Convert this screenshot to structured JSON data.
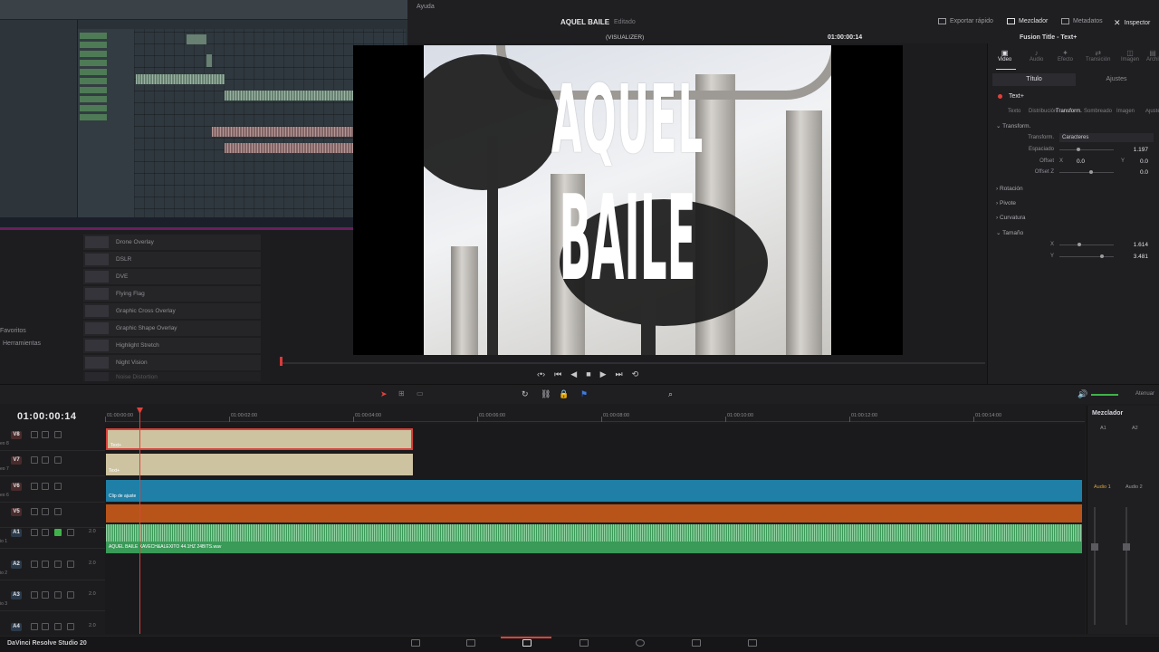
{
  "menu": {
    "help": "Ayuda"
  },
  "project": {
    "name": "AQUEL BAILE",
    "status": "Editado"
  },
  "topbar": {
    "quick_export": "Exportar rápido",
    "mixer": "Mezclador",
    "metadata": "Metadatos",
    "inspector": "Inspector"
  },
  "viewer": {
    "mode": "(VISUALIZER)",
    "timecode": "01:00:00:14",
    "title_line1": "AQUEL",
    "title_line2": "BAILE"
  },
  "effects": {
    "items": [
      "Drone Overlay",
      "DSLR",
      "DVE",
      "Flying Flag",
      "Graphic Cross Overlay",
      "Graphic Shape Overlay",
      "Highlight Stretch",
      "Night Vision",
      "Noise Distortion"
    ],
    "favorites": "Favoritos",
    "tools": "Herramientas"
  },
  "inspector": {
    "title": "Fusion Title - Text+",
    "tabs": [
      "Video",
      "Audio",
      "Efecto",
      "Transición",
      "Imagen",
      "Archivo"
    ],
    "seg_title": "Título",
    "seg_settings": "Ajustes",
    "node": "Text+",
    "subtabs": [
      "Texto",
      "Distribución",
      "Transform.",
      "Sombreado",
      "Imagen",
      "Ajustes"
    ],
    "transform_section": "Transform.",
    "transform_label": "Transform.",
    "transform_value": "Caracteres",
    "spacing_label": "Espaciado",
    "spacing_value": "1.197",
    "offset_label": "Offset",
    "offset_x_label": "X",
    "offset_x": "0.0",
    "offset_y_label": "Y",
    "offset_y": "0.0",
    "offset_z_label": "Offset Z",
    "offset_z": "0.0",
    "rotation": "Rotación",
    "pivot": "Pivote",
    "curvature": "Curvatura",
    "size": "Tamaño",
    "size_x_label": "X",
    "size_x": "1.614",
    "size_y_label": "Y",
    "size_y": "3.481"
  },
  "timeline": {
    "timecode": "01:00:00:14",
    "ruler": [
      "01:00:00:00",
      "01:00:02:00",
      "01:00:04:00",
      "01:00:06:00",
      "01:00:08:00",
      "01:00:10:00",
      "01:00:12:00",
      "01:00:14:00"
    ],
    "tracks": [
      {
        "id": "V8",
        "side": "eo 8",
        "kind": "v",
        "ch": ""
      },
      {
        "id": "V7",
        "side": "eo 7",
        "kind": "v",
        "ch": ""
      },
      {
        "id": "V6",
        "side": "eo 6",
        "kind": "v",
        "ch": ""
      },
      {
        "id": "V5",
        "side": "",
        "kind": "v",
        "ch": ""
      },
      {
        "id": "A1",
        "side": "io 1",
        "kind": "a",
        "ch": "2.0"
      },
      {
        "id": "A2",
        "side": "io 2",
        "kind": "a",
        "ch": "2.0"
      },
      {
        "id": "A3",
        "side": "io 3",
        "kind": "a",
        "ch": "2.0"
      },
      {
        "id": "A4",
        "side": "",
        "kind": "a",
        "ch": "2.0"
      }
    ],
    "clip_v8": "Text+",
    "clip_v7": "Text+",
    "clip_v6": "Clip de ajuste",
    "clip_a1": "AQUEL BAILE KAVECH&ALEXITO 44.1HZ 24BITS.wav",
    "mute_all": "Atenuar"
  },
  "mixer": {
    "title": "Mezclador",
    "ch1": "A1",
    "ch2": "A2",
    "bus1": "Audio 1",
    "bus2": "Audio 2"
  },
  "app": {
    "name": "DaVinci Resolve Studio 20"
  },
  "colors": {
    "accent_red": "#d9423b",
    "text_clip": "#cdc3a0",
    "adjustment_clip": "#1f7fa6",
    "audio_clip": "#3a9a58",
    "orange_clip": "#b8541a"
  }
}
